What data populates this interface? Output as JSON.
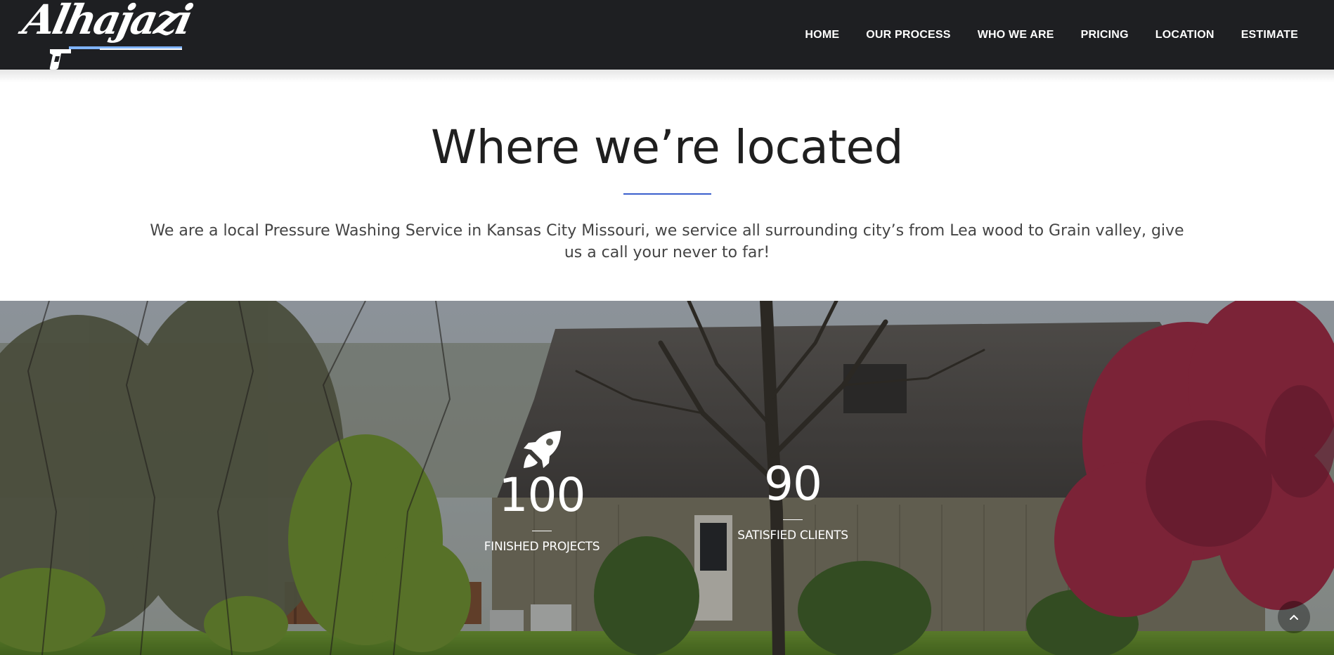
{
  "brand": {
    "logo_text": "Alhajazi"
  },
  "nav": {
    "items": [
      {
        "label": "HOME"
      },
      {
        "label": "OUR PROCESS"
      },
      {
        "label": "WHO WE ARE"
      },
      {
        "label": "PRICING"
      },
      {
        "label": "LOCATION"
      },
      {
        "label": "ESTIMATE"
      }
    ]
  },
  "location": {
    "title": "Where we’re located",
    "description": "We are a local Pressure Washing Service in Kansas City Missouri, we service all surrounding city’s from Lea wood to Grain valley, give us a call your never to far!"
  },
  "stats": {
    "items": [
      {
        "icon": "rocket-icon",
        "value": "100",
        "label": "FINISHED PROJECTS"
      },
      {
        "value": "90",
        "label": "SATISFIED CLIENTS"
      }
    ]
  },
  "back_to_top": {
    "icon": "chevron-up-icon"
  },
  "colors": {
    "header_bg": "#1e1f22",
    "accent": "#3a5fcd",
    "logo_accent": "#7fb3ff"
  }
}
